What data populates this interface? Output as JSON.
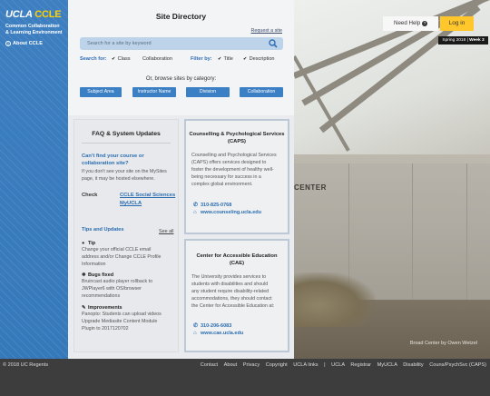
{
  "sidebar": {
    "logo_ucla": "UCLA",
    "logo_ccle": "CCLE",
    "subtitle_line1": "Common Collaboration",
    "subtitle_line2": "& Learning Environment",
    "about_label": "About CCLE"
  },
  "header": {
    "title": "Site Directory",
    "request_link": "Request a site",
    "search_placeholder": "Search for a site by keyword",
    "search_for_label": "Search for:",
    "search_for_options": [
      "Class",
      "Collaboration"
    ],
    "filter_by_label": "Filter by:",
    "filter_by_options": [
      "Title",
      "Description"
    ],
    "browse_text": "Or, browse sites by category:",
    "categories": [
      "Subject Area",
      "Instructor Name",
      "Division",
      "Collaboration"
    ]
  },
  "faq": {
    "title": "FAQ & System Updates",
    "cant_find_line1": "Can't find your course or",
    "cant_find_line2": "collaboration site?",
    "cant_find_body1": "If you don't see your site on the MySites",
    "cant_find_body2": "page, it may be hosted elsewhere.",
    "check_label": "Check",
    "check_links": [
      "CCLE Social Sciences",
      "MyUCLA"
    ],
    "tips_title": "Tips and Updates",
    "see_all": "See all",
    "items": [
      {
        "icon": "lightbulb-icon",
        "glyph": "💡",
        "head": "Tip",
        "lines": [
          "Change your official CCLE email",
          "address and/or Change CCLE Profile",
          "Information"
        ]
      },
      {
        "icon": "bug-icon",
        "glyph": "✱",
        "head": "Bugs fixed",
        "lines": [
          "Bruincast audio player rollback to",
          "JWPlayer6 with OS/browser",
          "recommendations"
        ]
      },
      {
        "icon": "wrench-icon",
        "glyph": "✎",
        "head": "Improvements",
        "lines": [
          "Panopto: Students can upload videos",
          "Upgrade Mediasite Content Module",
          "Plugin to 2017120702"
        ]
      }
    ]
  },
  "caps": {
    "title_line1": "Counselling & Psychological Services",
    "title_line2": "(CAPS)",
    "body": [
      "Counselling and Psychological Services",
      "(CAPS) offers services designed to",
      "foster the development of healthy well-",
      "being necessary for success in a",
      "complex global environment."
    ],
    "phone": "310-825-0768",
    "website": "www.counseling.ucla.edu"
  },
  "cae": {
    "title_line1": "Center for Accessible Education",
    "title_line2": "(CAE)",
    "body": [
      "The University provides services to",
      "students with disabilities and should",
      "any student require disability-related",
      "accommodations, they should contact",
      "the Center for Accessible Education at:"
    ],
    "phone": "310-206-6083",
    "website": "www.cae.ucla.edu"
  },
  "topbar": {
    "need_help": "Need Help",
    "login": "Log in",
    "term": "Spring 2018",
    "week": "Week 3"
  },
  "photo": {
    "sign_text": "CENTER",
    "credit": "Broad Center by Owen Wetzel"
  },
  "footer": {
    "copyright": "© 2018 UC Regents",
    "links": [
      "Contact",
      "About",
      "Privacy",
      "Copyright",
      "UCLA links",
      "|",
      "UCLA",
      "Registrar",
      "MyUCLA",
      "Disability",
      "Couns/PsychSvc (CAPS)"
    ]
  },
  "colors": {
    "sidebar_blue": "#3679bb",
    "accent_gold": "#ffc72c",
    "link_blue": "#2a6cb0",
    "button_blue": "#3b7fc4"
  }
}
